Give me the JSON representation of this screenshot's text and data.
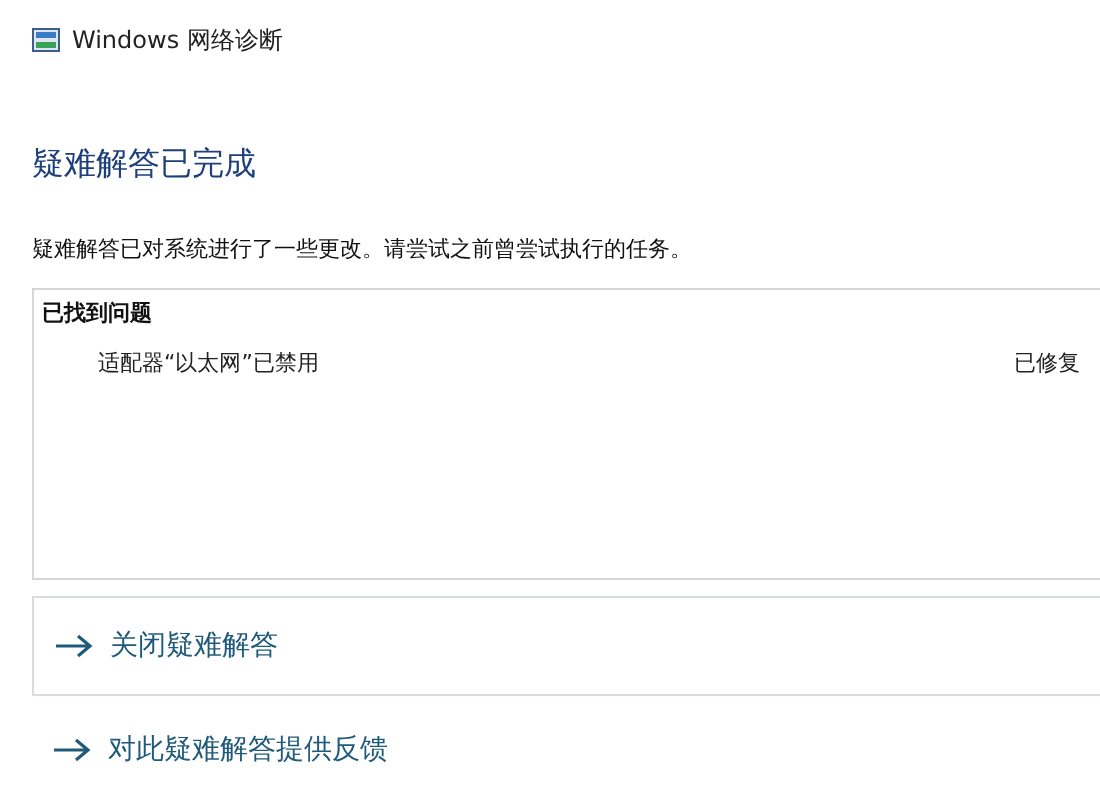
{
  "window": {
    "title": "Windows 网络诊断"
  },
  "heading": "疑难解答已完成",
  "description": "疑难解答已对系统进行了一些更改。请尝试之前曾尝试执行的任务。",
  "problems": {
    "title": "已找到问题",
    "rows": [
      {
        "name": "适配器“以太网”已禁用",
        "status": "已修复"
      }
    ]
  },
  "links": [
    {
      "label": "关闭疑难解答",
      "boxed": true
    },
    {
      "label": "对此疑难解答提供反馈",
      "boxed": false
    }
  ]
}
